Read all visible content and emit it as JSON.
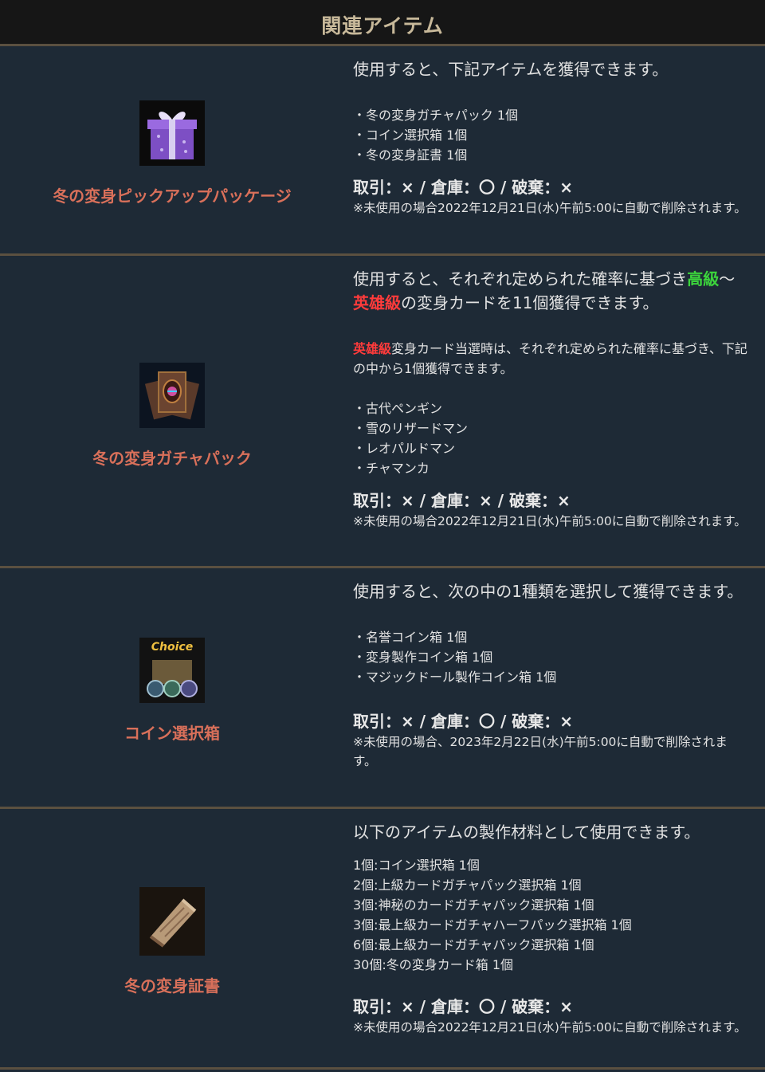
{
  "header": {
    "title": "関連アイテム"
  },
  "items": [
    {
      "name": "冬の変身ピックアップパッケージ",
      "icon": "gift-box-icon",
      "lead": "使用すると、下記アイテムを獲得できます。",
      "list": [
        "・冬の変身ガチャパック 1個",
        "・コイン選択箱 1個",
        "・冬の変身証書 1個"
      ],
      "trade": "取引：× / 倉庫：〇 / 破棄：×",
      "note": "※未使用の場合2022年12月21日(水)午前5:00に自動で削除されます。"
    },
    {
      "name": "冬の変身ガチャパック",
      "icon": "card-pack-icon",
      "lead_part1": "使用すると、それぞれ定められた確率に基づき",
      "lead_green": "高級",
      "lead_part2": "～",
      "lead_red": "英雄級",
      "lead_part3": "の変身カードを11個獲得できます。",
      "sub_red": "英雄級",
      "sub_text": "変身カード当選時は、それぞれ定められた確率に基づき、下記の中から1個獲得できます。",
      "list": [
        "・古代ペンギン",
        "・雪のリザードマン",
        "・レオパルドマン",
        "・チャマンカ"
      ],
      "trade": "取引：× / 倉庫：× / 破棄：×",
      "note": "※未使用の場合2022年12月21日(水)午前5:00に自動で削除されます。"
    },
    {
      "name": "コイン選択箱",
      "icon": "coin-choice-icon",
      "icon_text": "Choice",
      "lead": "使用すると、次の中の1種類を選択して獲得できます。",
      "list": [
        "・名誉コイン箱 1個",
        "・変身製作コイン箱 1個",
        "・マジックドール製作コイン箱 1個"
      ],
      "trade": "取引：× / 倉庫：〇 / 破棄：×",
      "note": "※未使用の場合、2023年2月22日(水)午前5:00に自動で削除されます。"
    },
    {
      "name": "冬の変身証書",
      "icon": "scroll-icon",
      "lead": "以下のアイテムの製作材料として使用できます。",
      "list": [
        "1個:コイン選択箱 1個",
        "2個:上級カードガチャパック選択箱 1個",
        "3個:神秘のカードガチャパック選択箱 1個",
        "3個:最上級カードガチャハーフパック選択箱 1個",
        "6個:最上級カードガチャパック選択箱 1個",
        "30個:冬の変身カード箱 1個"
      ],
      "trade": "取引：× / 倉庫：〇 / 破棄：×",
      "note": "※未使用の場合2022年12月21日(水)午前5:00に自動で削除されます。"
    }
  ]
}
